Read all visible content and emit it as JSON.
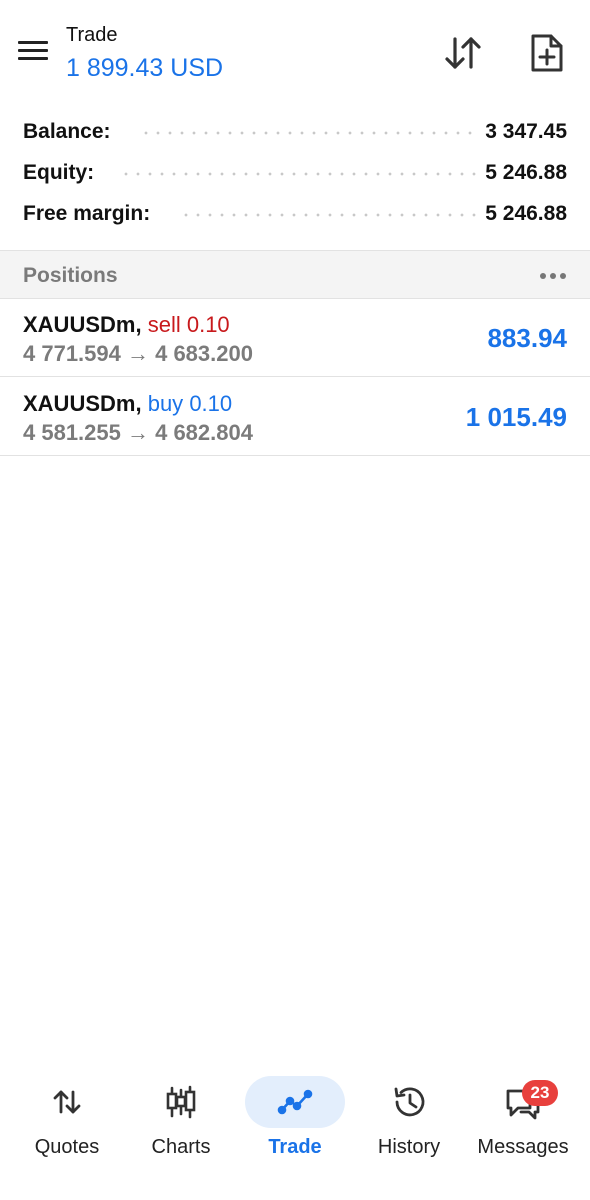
{
  "header": {
    "title": "Trade",
    "balance_display": "1 899.43 USD"
  },
  "summary": [
    {
      "label": "Balance:",
      "value": "3 347.45"
    },
    {
      "label": "Equity:",
      "value": "5 246.88"
    },
    {
      "label": "Free margin:",
      "value": "5 246.88"
    }
  ],
  "positions": {
    "title": "Positions",
    "items": [
      {
        "symbol": "XAUUSDm,",
        "side": "sell",
        "volume": "0.10",
        "prices": "4 771.594 → 4 683.200",
        "profit": "883.94"
      },
      {
        "symbol": "XAUUSDm,",
        "side": "buy",
        "volume": "0.10",
        "prices": "4 581.255 → 4 682.804",
        "profit": "1 015.49"
      }
    ]
  },
  "nav": {
    "items": [
      {
        "label": "Quotes",
        "icon": "quotes-arrows-icon"
      },
      {
        "label": "Charts",
        "icon": "candlestick-icon"
      },
      {
        "label": "Trade",
        "icon": "trade-line-icon"
      },
      {
        "label": "History",
        "icon": "history-clock-icon"
      },
      {
        "label": "Messages",
        "icon": "messages-icon"
      }
    ],
    "active": "Trade",
    "messages_badge": "23"
  },
  "colors": {
    "accent": "#1a73e8",
    "sell": "#c8191c",
    "badge": "#e8403d",
    "active_pill": "#e3eefc"
  }
}
